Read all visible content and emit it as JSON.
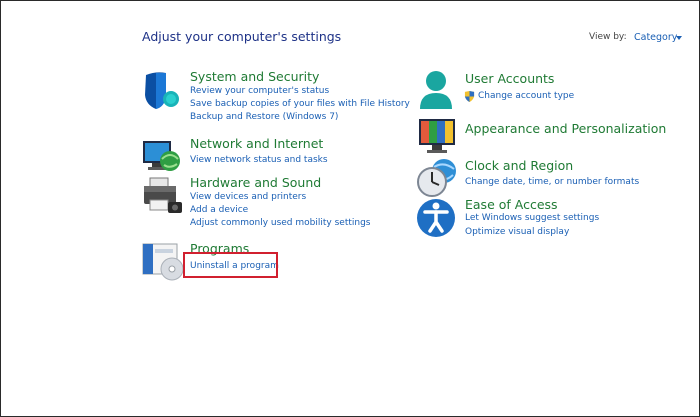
{
  "header": {
    "title": "Adjust your computer's settings",
    "view_by_label": "View by:",
    "view_by_value": "Category"
  },
  "left_categories": [
    {
      "title": "System and Security",
      "icon": "shield-icon",
      "links": [
        "Review your computer's status",
        "Save backup copies of your files with File History",
        "Backup and Restore (Windows 7)"
      ]
    },
    {
      "title": "Network and Internet",
      "icon": "network-globe-icon",
      "links": [
        "View network status and tasks"
      ]
    },
    {
      "title": "Hardware and Sound",
      "icon": "printer-icon",
      "links": [
        "View devices and printers",
        "Add a device",
        "Adjust commonly used mobility settings"
      ]
    },
    {
      "title": "Programs",
      "icon": "programs-disc-icon",
      "links": [
        "Uninstall a program"
      ]
    }
  ],
  "right_categories": [
    {
      "title": "User Accounts",
      "icon": "user-icon",
      "links": [
        "Change account type"
      ],
      "link_icon": "uac-shield-icon"
    },
    {
      "title": "Appearance and Personalization",
      "icon": "monitor-icon",
      "links": []
    },
    {
      "title": "Clock and Region",
      "icon": "clock-globe-icon",
      "links": [
        "Change date, time, or number formats"
      ]
    },
    {
      "title": "Ease of Access",
      "icon": "accessibility-icon",
      "links": [
        "Let Windows suggest settings",
        "Optimize visual display"
      ]
    }
  ],
  "highlight": {
    "target": "Uninstall a program",
    "color": "#d1202f"
  },
  "colors": {
    "heading_green": "#1f7a34",
    "link_blue": "#1a5fb4",
    "title_navy": "#1e3287"
  }
}
